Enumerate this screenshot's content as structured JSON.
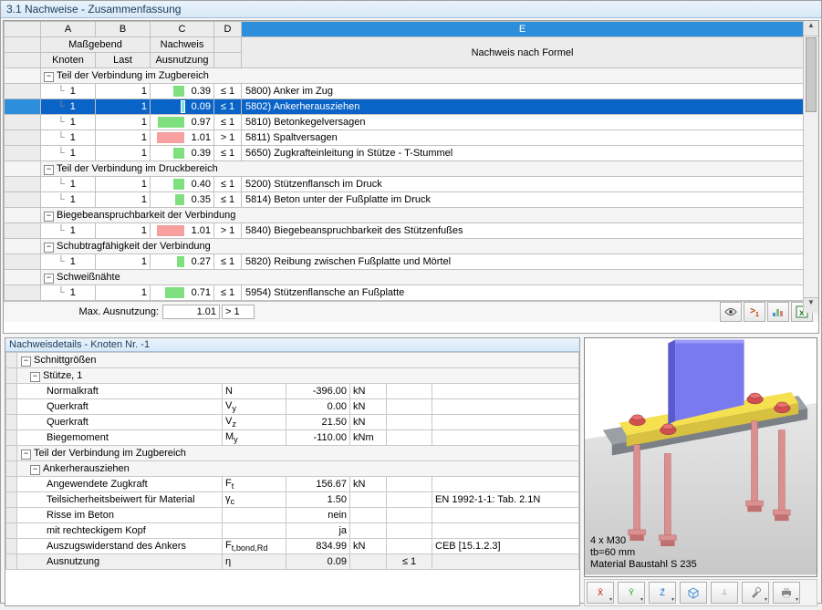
{
  "title": "3.1 Nachweise - Zusammenfassung",
  "cols": {
    "A": "A",
    "B": "B",
    "C": "C",
    "D": "D",
    "E": "E",
    "ab": "Maßgebend",
    "c": "Nachweis",
    "a": "Knoten",
    "b": "Last",
    "c2": "Ausnutzung",
    "e": "Nachweis nach Formel"
  },
  "groups": [
    {
      "title": "Teil der Verbindung im Zugbereich",
      "rows": [
        {
          "k": "1",
          "l": "1",
          "u": 0.39,
          "cmp": "≤ 1",
          "bar": "#7fe07f",
          "txt": "5800) Anker im Zug",
          "sel": false
        },
        {
          "k": "1",
          "l": "1",
          "u": 0.09,
          "cmp": "≤ 1",
          "bar": "#7fe0e0",
          "txt": "5802) Ankerherausziehen",
          "sel": true
        },
        {
          "k": "1",
          "l": "1",
          "u": 0.97,
          "cmp": "≤ 1",
          "bar": "#7fe07f",
          "txt": "5810) Betonkegelversagen",
          "sel": false
        },
        {
          "k": "1",
          "l": "1",
          "u": 1.01,
          "cmp": "> 1",
          "bar": "#f8a0a0",
          "txt": "5811) Spaltversagen",
          "sel": false
        },
        {
          "k": "1",
          "l": "1",
          "u": 0.39,
          "cmp": "≤ 1",
          "bar": "#7fe07f",
          "txt": "5650) Zugkrafteinleitung in Stütze - T-Stummel",
          "sel": false
        }
      ]
    },
    {
      "title": "Teil der Verbindung im Druckbereich",
      "rows": [
        {
          "k": "1",
          "l": "1",
          "u": 0.4,
          "cmp": "≤ 1",
          "bar": "#7fe07f",
          "txt": "5200) Stützenflansch im Druck",
          "sel": false
        },
        {
          "k": "1",
          "l": "1",
          "u": 0.35,
          "cmp": "≤ 1",
          "bar": "#7fe07f",
          "txt": "5814) Beton unter der Fußplatte im Druck",
          "sel": false
        }
      ]
    },
    {
      "title": "Biegebeanspruchbarkeit der Verbindung",
      "rows": [
        {
          "k": "1",
          "l": "1",
          "u": 1.01,
          "cmp": "> 1",
          "bar": "#f8a0a0",
          "txt": "5840) Biegebeanspruchbarkeit des Stützenfußes",
          "sel": false
        }
      ]
    },
    {
      "title": "Schubtragfähigkeit der Verbindung",
      "rows": [
        {
          "k": "1",
          "l": "1",
          "u": 0.27,
          "cmp": "≤ 1",
          "bar": "#7fe07f",
          "txt": "5820) Reibung zwischen Fußplatte und Mörtel",
          "sel": false
        }
      ]
    },
    {
      "title": "Schweißnähte",
      "rows": [
        {
          "k": "1",
          "l": "1",
          "u": 0.71,
          "cmp": "≤ 1",
          "bar": "#7fe07f",
          "txt": "5954) Stützenflansche an Fußplatte",
          "sel": false
        }
      ]
    }
  ],
  "footer": {
    "label": "Max. Ausnutzung:",
    "val": "1.01",
    "cmp": "> 1"
  },
  "details_title": "Nachweisdetails - Knoten Nr. -1",
  "details": [
    {
      "type": "sec",
      "lvl": 0,
      "label": "Schnittgrößen"
    },
    {
      "type": "sec",
      "lvl": 1,
      "label": "Stütze, 1"
    },
    {
      "type": "row",
      "lvl": 2,
      "label": "Normalkraft",
      "sym": "N",
      "val": "-396.00",
      "unit": "kN",
      "ref": ""
    },
    {
      "type": "row",
      "lvl": 2,
      "label": "Querkraft",
      "sym": "V y",
      "val": "0.00",
      "unit": "kN",
      "ref": ""
    },
    {
      "type": "row",
      "lvl": 2,
      "label": "Querkraft",
      "sym": "V z",
      "val": "21.50",
      "unit": "kN",
      "ref": ""
    },
    {
      "type": "row",
      "lvl": 2,
      "label": "Biegemoment",
      "sym": "M y",
      "val": "-110.00",
      "unit": "kNm",
      "ref": ""
    },
    {
      "type": "sec",
      "lvl": 0,
      "label": "Teil der Verbindung im Zugbereich"
    },
    {
      "type": "sec",
      "lvl": 1,
      "label": "Ankerherausziehen"
    },
    {
      "type": "row",
      "lvl": 2,
      "label": "Angewendete Zugkraft",
      "sym": "F t",
      "val": "156.67",
      "unit": "kN",
      "ref": ""
    },
    {
      "type": "row",
      "lvl": 2,
      "label": "Teilsicherheitsbeiwert für Material",
      "sym": "γ c",
      "val": "1.50",
      "unit": "",
      "ref": "EN 1992-1-1: Tab. 2.1N"
    },
    {
      "type": "row",
      "lvl": 2,
      "label": "Risse im Beton",
      "sym": "",
      "val": "nein",
      "unit": "",
      "ref": ""
    },
    {
      "type": "row",
      "lvl": 2,
      "label": "mit rechteckigem Kopf",
      "sym": "",
      "val": "ja",
      "unit": "",
      "ref": ""
    },
    {
      "type": "row",
      "lvl": 2,
      "label": "Auszugswiderstand des Ankers",
      "sym": "F t,bond,Rd",
      "val": "834.99",
      "unit": "kN",
      "ref": "CEB [15.1.2.3]"
    },
    {
      "type": "row",
      "lvl": 2,
      "label": "Ausnutzung",
      "sym": "η",
      "val": "0.09",
      "unit": "",
      "ref": "≤ 1",
      "hl": true
    }
  ],
  "viewer": {
    "line1": "4 x M30",
    "line2": "tb=60 mm",
    "line3": "Material Baustahl S 235"
  },
  "axis": {
    "x": "X̄",
    "y": "Ȳ",
    "z": "Z̄"
  }
}
